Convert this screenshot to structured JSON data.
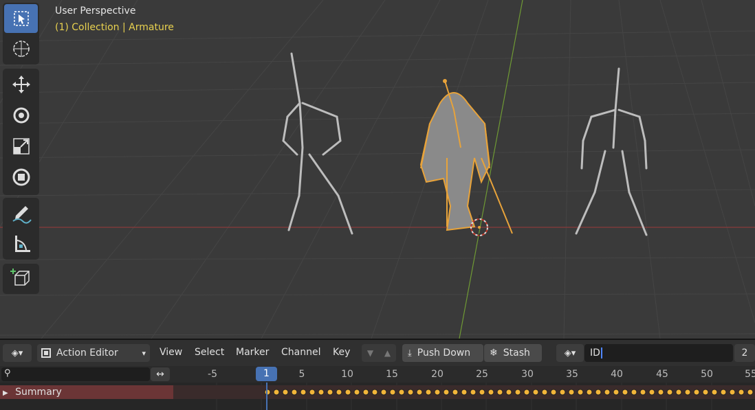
{
  "viewport": {
    "title": "User Perspective",
    "subtitle": "(1) Collection | Armature"
  },
  "toolbar": {
    "tools": [
      {
        "name": "select-box-icon",
        "active": true
      },
      {
        "name": "cursor-icon"
      },
      {
        "name": "move-icon"
      },
      {
        "name": "rotate-icon"
      },
      {
        "name": "scale-icon"
      },
      {
        "name": "transform-icon"
      },
      {
        "name": "annotate-icon"
      },
      {
        "name": "measure-icon"
      },
      {
        "name": "add-cube-icon"
      }
    ]
  },
  "editor": {
    "editor_type": "Action Editor",
    "menus": [
      "View",
      "Select",
      "Marker",
      "Channel",
      "Key"
    ],
    "push_down": "Push Down",
    "stash": "Stash",
    "action_name": "ID",
    "users": "2"
  },
  "timeline": {
    "current_frame": "1",
    "ticks": [
      "-5",
      "5",
      "10",
      "15",
      "20",
      "25",
      "30",
      "35",
      "40",
      "45",
      "50",
      "55"
    ]
  },
  "channels": {
    "summary": "Summary"
  },
  "colors": {
    "accent": "#4772b3",
    "selected": "#e8a33a",
    "overlay_sub": "#e8d14f",
    "summary_bg": "#6b3536"
  }
}
